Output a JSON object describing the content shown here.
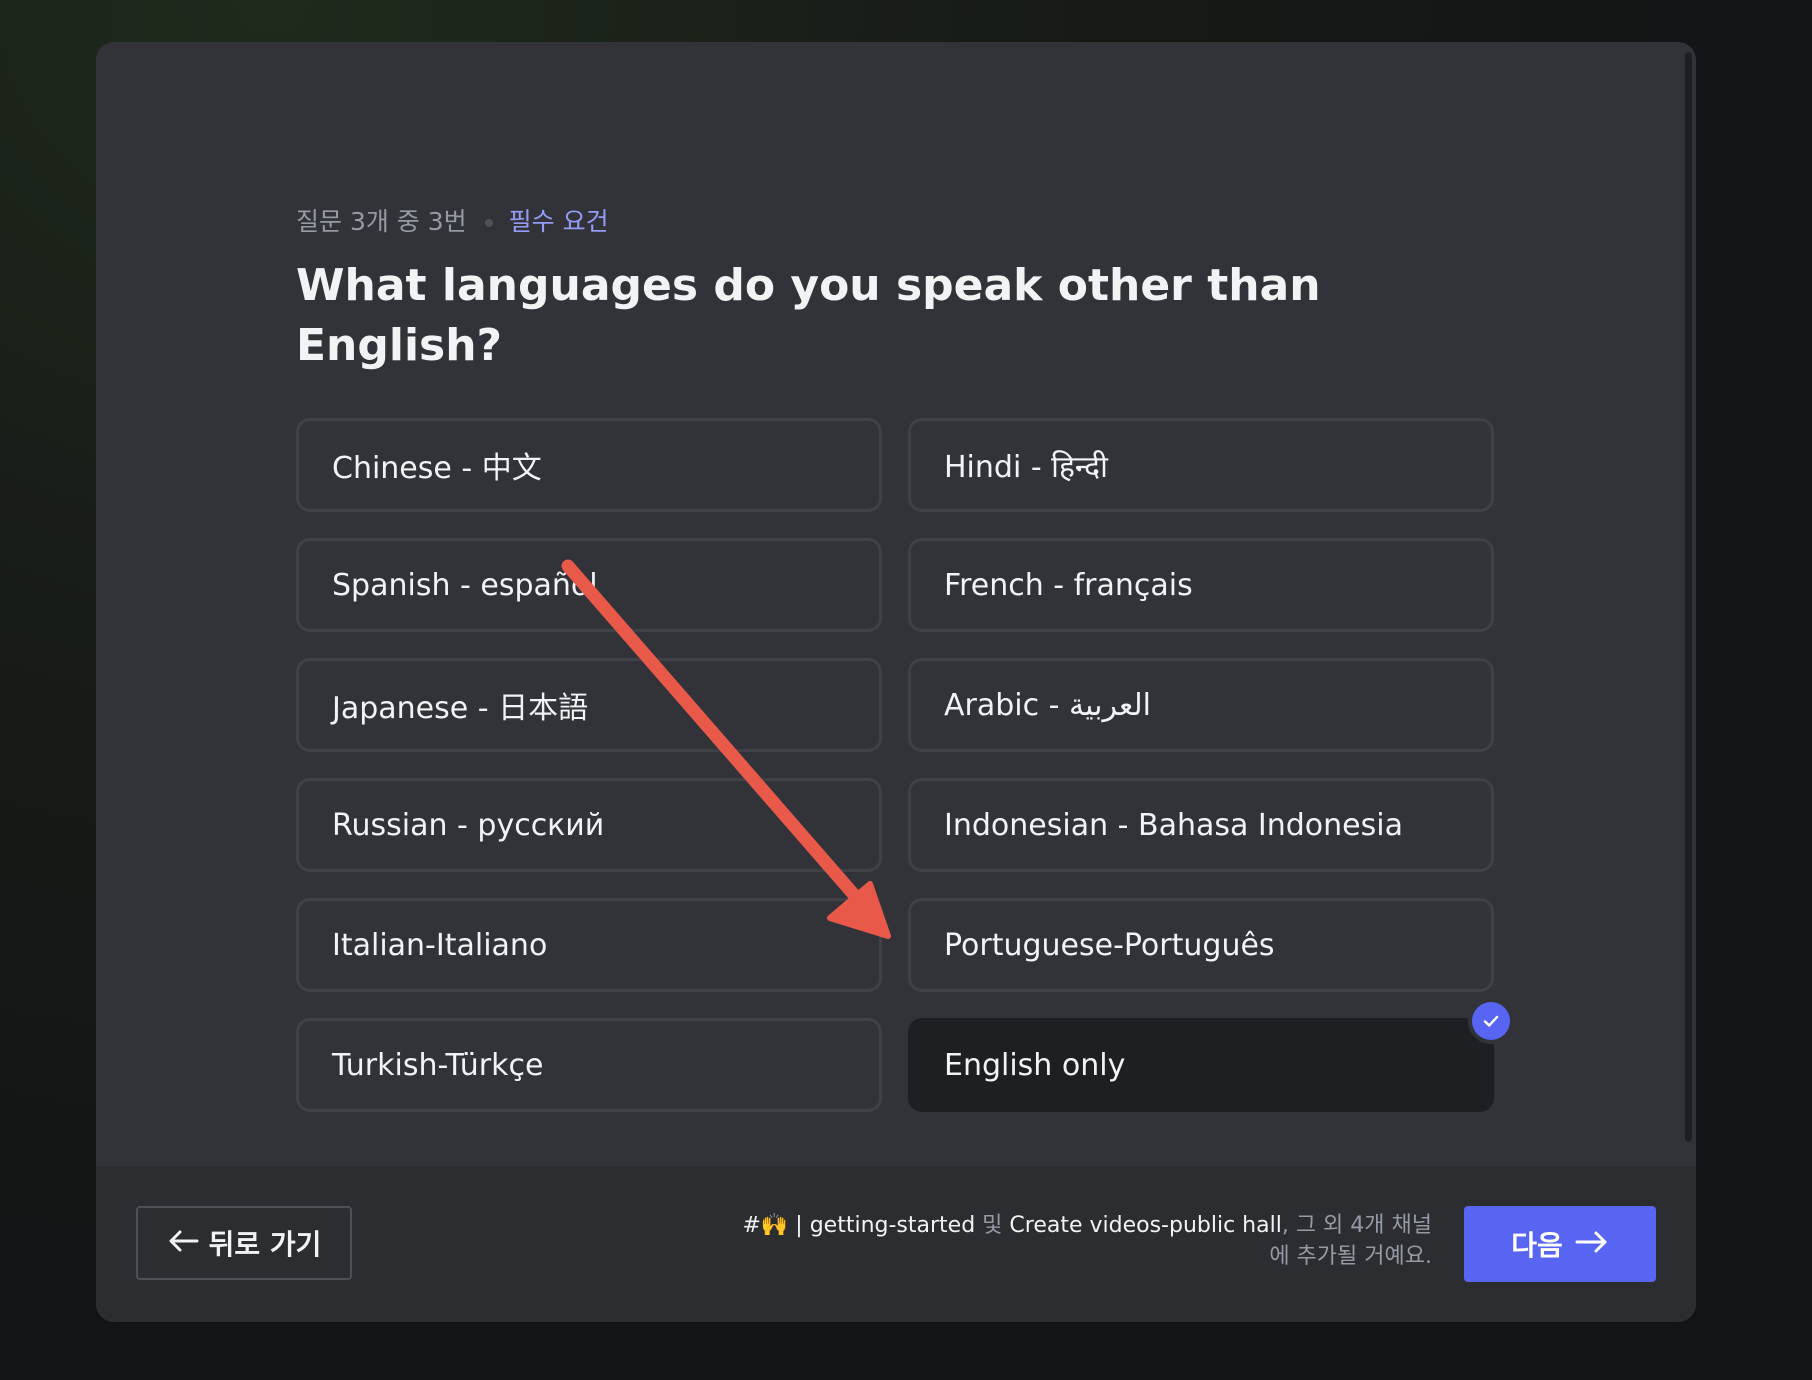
{
  "header": {
    "progress": "질문 3개 중 3번",
    "required": "필수 요건",
    "question": "What languages do you speak other than English?"
  },
  "options": [
    {
      "label": "Chinese - 中文",
      "selected": false
    },
    {
      "label": "Hindi - हिन्दी",
      "selected": false
    },
    {
      "label": "Spanish - español",
      "selected": false
    },
    {
      "label": "French - français",
      "selected": false
    },
    {
      "label": "Japanese - 日本語",
      "selected": false
    },
    {
      "label": "Arabic - العربية",
      "selected": false
    },
    {
      "label": "Russian - русский",
      "selected": false
    },
    {
      "label": "Indonesian - Bahasa Indonesia",
      "selected": false
    },
    {
      "label": "Italian-Italiano",
      "selected": false
    },
    {
      "label": "Portuguese-Português",
      "selected": false
    },
    {
      "label": "Turkish-Türkçe",
      "selected": false
    },
    {
      "label": "English only",
      "selected": true
    }
  ],
  "footer": {
    "back_label": "뒤로 가기",
    "note_channel_1": "#🙌 | getting-started",
    "note_and": " 및 ",
    "note_channel_2": "Create videos-public hall",
    "note_rest": ", 그 외 4개 채널에 추가될 거예요.",
    "next_label": "다음"
  },
  "colors": {
    "accent": "#5865f2",
    "required_text": "#949cf7",
    "annotation_arrow": "#e8594a"
  },
  "icons": {
    "back": "arrow-left-icon",
    "next": "arrow-right-icon",
    "check": "checkmark-icon"
  }
}
